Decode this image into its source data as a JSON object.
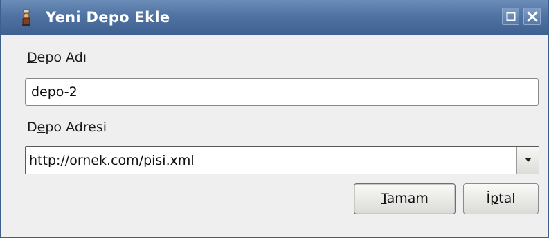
{
  "window": {
    "title": "Yeni Depo Ekle",
    "icon": "pisi-app-icon",
    "controls": {
      "maximize": "maximize-icon",
      "close": "close-icon"
    },
    "colors": {
      "titlebar": "#4f73a3",
      "titlebar_text": "#ffffff"
    }
  },
  "form": {
    "name_label": {
      "mnemonic": "D",
      "rest": "epo Adı"
    },
    "name_value": "depo-2",
    "address_label": {
      "pre": "D",
      "mnemonic": "e",
      "rest": "po Adresi"
    },
    "address_value": "http://ornek.com/pisi.xml"
  },
  "buttons": {
    "ok": {
      "mnemonic": "T",
      "rest": "amam"
    },
    "cancel": {
      "pre": "İ",
      "mnemonic": "p",
      "rest": "tal"
    }
  }
}
